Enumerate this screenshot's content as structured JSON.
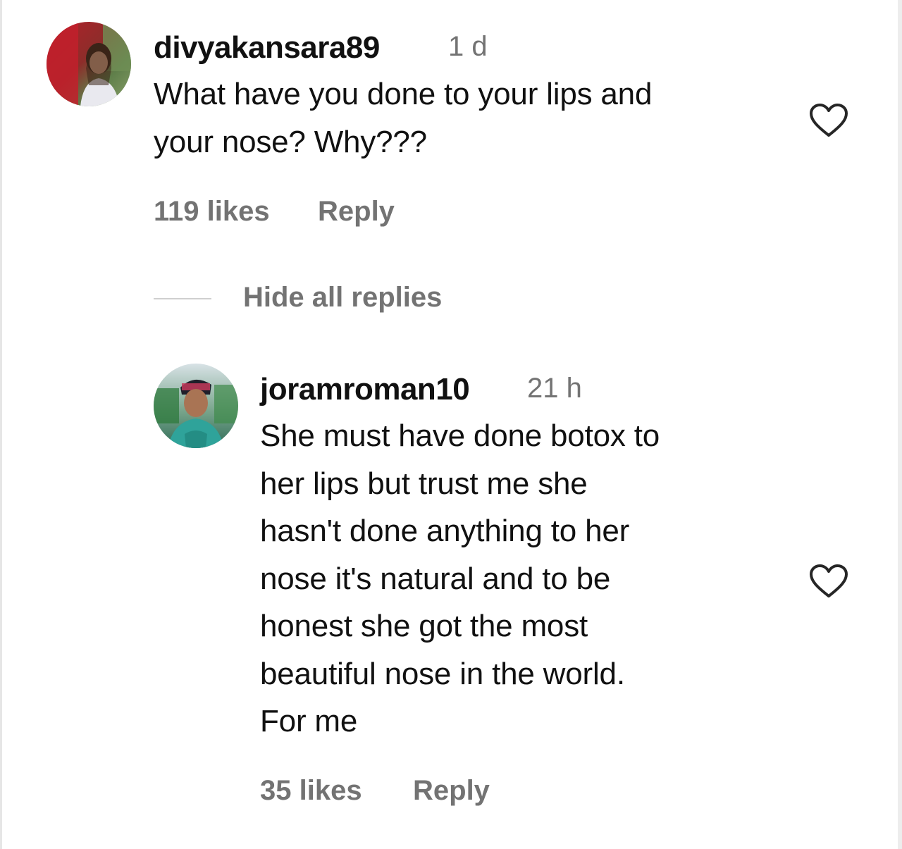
{
  "comments": [
    {
      "username": "divyakansara89",
      "time": "1 d",
      "text_lines": [
        "What have you done to your lips and",
        "your nose? Why???"
      ],
      "likes": "119 likes",
      "reply_label": "Reply",
      "avatar": "avatar-woman-photo",
      "like_icon": "heart-outline-icon"
    }
  ],
  "replies_toggle": "Hide all replies",
  "replies": [
    {
      "username": "joramroman10",
      "time": "21 h",
      "text_lines": [
        "She must have done botox to",
        "her lips but trust me she",
        "hasn't done anything to her",
        "nose it's natural and to be",
        "honest she got the most",
        "beautiful nose in the world.",
        "For me"
      ],
      "likes": "35 likes",
      "reply_label": "Reply",
      "avatar": "avatar-man-photo",
      "like_icon": "heart-outline-icon"
    }
  ],
  "colors": {
    "text_primary": "#111111",
    "text_secondary": "#737373",
    "background": "#ffffff"
  }
}
